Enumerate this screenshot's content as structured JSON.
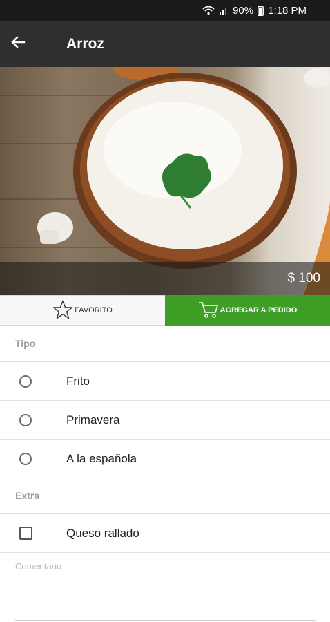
{
  "status_bar": {
    "battery": "90%",
    "time": "1:18 PM"
  },
  "app_bar": {
    "title": "Arroz"
  },
  "hero": {
    "price": "$ 100"
  },
  "actions": {
    "favorite_label": "FAVORITO",
    "add_label": "AGREGAR A PEDIDO"
  },
  "sections": {
    "tipo": {
      "header": "Tipo",
      "options": [
        "Frito",
        "Primavera",
        "A la española"
      ]
    },
    "extra": {
      "header": "Extra",
      "options": [
        "Queso rallado"
      ]
    }
  },
  "comment": {
    "placeholder": "Comentario"
  },
  "colors": {
    "accent_green": "#3e9e25",
    "app_bar": "#2f2f2f",
    "status_bar": "#1b1b1b"
  }
}
